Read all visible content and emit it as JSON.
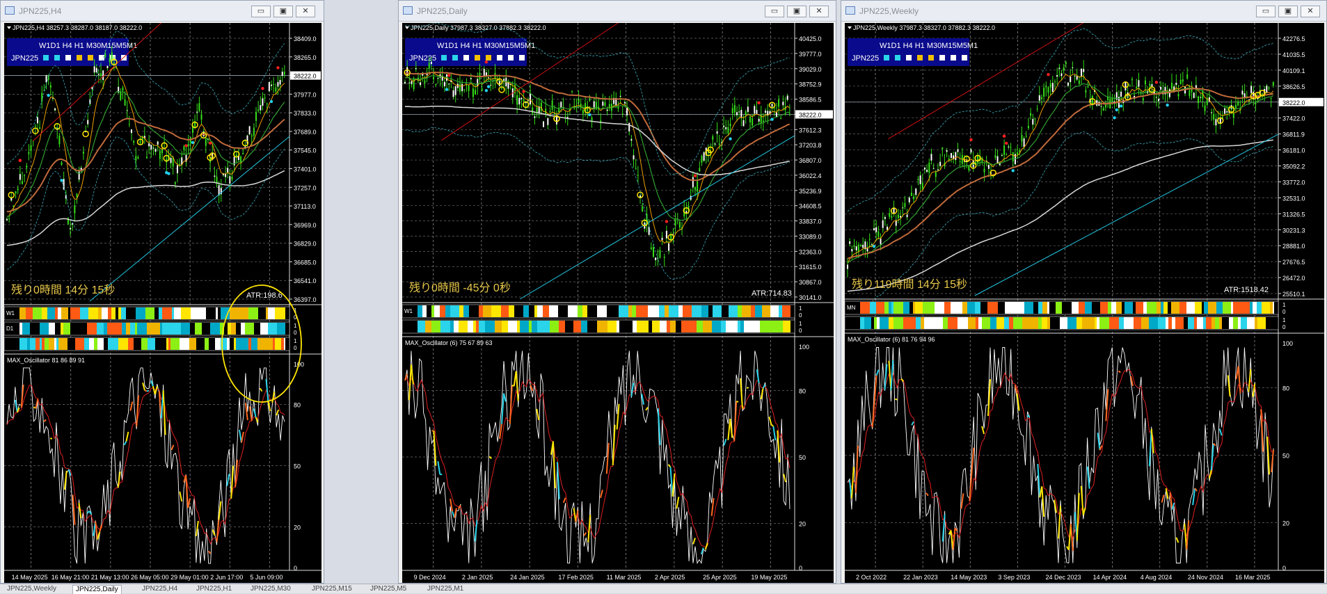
{
  "windows": [
    {
      "title": "JPN225,H4",
      "info": "JPN225,H4  38257.3 38287.0 38187.0 38222.0",
      "ohlc": "",
      "box_title": "W1D1 H4 H1 M30M15M5M1",
      "box_symbol": "JPN225",
      "remaining": "残り0時間 14分 15秒",
      "atr": "ATR:198.6",
      "osc_label": "MAX_Oscillator 81 86 89 91",
      "price_labels": [
        "38409.0",
        "38265.0",
        "38222.0",
        "37977.0",
        "37833.0",
        "37689.0",
        "37545.0",
        "37401.0",
        "37257.0",
        "37113.0",
        "36969.0",
        "36829.0",
        "36685.0",
        "36541.0",
        "36397.0"
      ],
      "current_price": "38222.0",
      "osc_ticks": [
        "100",
        "80",
        "50",
        "20",
        "0"
      ],
      "band_labels": [
        "W1",
        "D1",
        ""
      ],
      "dates": [
        "14 May 2025",
        "16 May 21:00",
        "21 May 13:00",
        "26 May 05:00",
        "29 May 01:00",
        "2 Jun 17:00",
        "5 Jun 09:00"
      ]
    },
    {
      "title": "JPN225,Daily",
      "info": "JPN225,Daily  37987.3 38327.0 37882.3 38222.0",
      "box_title": "W1D1 H4 H1 M30M15M5M1",
      "box_symbol": "JPN225",
      "remaining": "残り0時間 -45分 0秒",
      "atr": "ATR:714.83",
      "osc_label": "MAX_Oscillator (6) 75 67 89 63",
      "price_labels": [
        "40425.0",
        "39777.0",
        "39029.0",
        "38752.9",
        "38586.5",
        "38222.0",
        "37612.3",
        "37203.8",
        "36807.0",
        "36022.4",
        "35236.9",
        "34608.5",
        "33837.0",
        "33089.0",
        "32363.0",
        "31615.0",
        "30867.0",
        "30141.0"
      ],
      "current_price": "38222.0",
      "osc_ticks": [
        "100",
        "80",
        "50",
        "20",
        "0"
      ],
      "band_labels": [
        "W1",
        ""
      ],
      "dates": [
        "9 Dec 2024",
        "2 Jan 2025",
        "24 Jan 2025",
        "17 Feb 2025",
        "11 Mar 2025",
        "2 Apr 2025",
        "25 Apr 2025",
        "19 May 2025"
      ]
    },
    {
      "title": "JPN225,Weekly",
      "info": "JPN225,Weekly  37987.3 38327.0 37882.3 38222.0",
      "box_title": "W1D1 H4 H1 M30M15M5M1",
      "box_symbol": "JPN225",
      "remaining": "残り119時間 14分 15秒",
      "atr": "ATR:1518.42",
      "osc_label": "MAX_Oscillator (6) 81 76 94 96",
      "price_labels": [
        "42276.5",
        "41035.5",
        "40109.1",
        "38626.5",
        "38222.0",
        "37422.0",
        "36811.9",
        "36181.0",
        "35092.2",
        "33772.0",
        "32531.0",
        "31326.5",
        "30231.3",
        "28881.0",
        "27676.5",
        "26472.0",
        "25510.1"
      ],
      "current_price": "38222.0",
      "osc_ticks": [
        "100",
        "80",
        "50",
        "20",
        "0"
      ],
      "band_labels": [
        "MN",
        ""
      ],
      "dates": [
        "2 Oct 2022",
        "22 Jan 2023",
        "14 May 2023",
        "3 Sep 2023",
        "24 Dec 2023",
        "14 Apr 2024",
        "4 Aug 2024",
        "24 Nov 2024",
        "16 Mar 2025"
      ]
    }
  ],
  "tabs": [
    "JPN225,Weekly",
    "JPN225,Daily",
    "JPN225,H4",
    "JPN225,H1",
    "JPN225,M30",
    "JPN225,M15",
    "JPN225,M5",
    "JPN225,M1"
  ],
  "active_tab": 1,
  "colors": {
    "candle_up": "#35e019",
    "box_bg": "#0a0a8c",
    "remaining": "#e8c84a",
    "osc_white": "#ffffff",
    "osc_red": "#e02020",
    "osc_cyan": "#2ad4ea",
    "osc_orange": "#ff6a20",
    "osc_yellow": "#ffe600",
    "trend_red": "#d01010",
    "trend_cyan": "#22c6e0"
  }
}
